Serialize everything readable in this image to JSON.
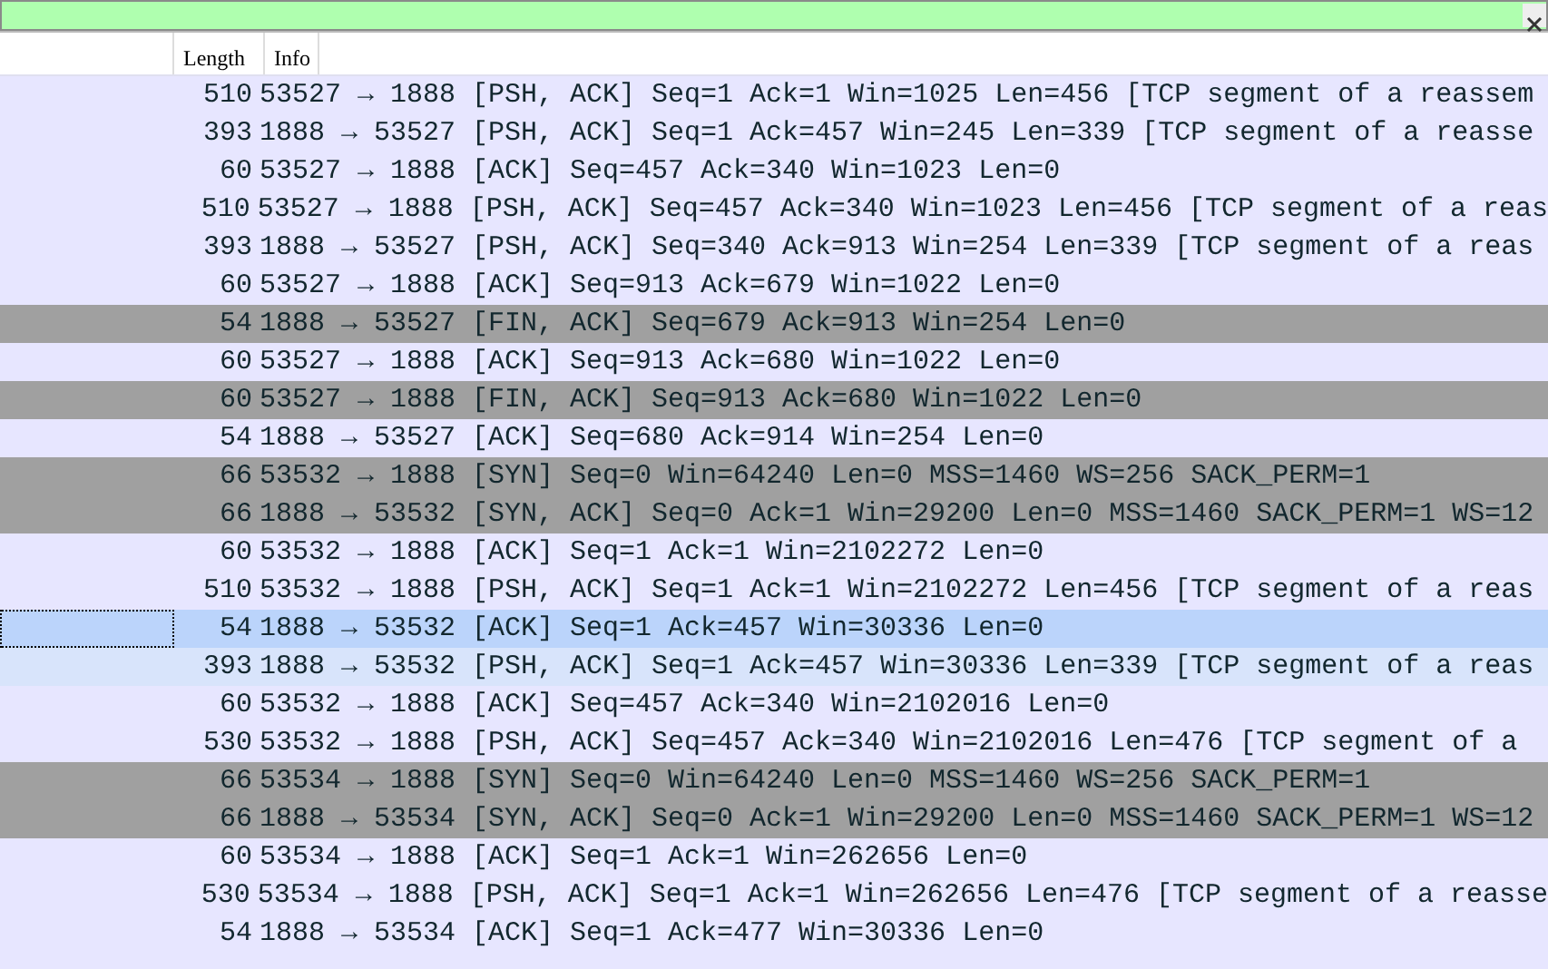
{
  "filter_bar": {
    "valid": true
  },
  "columns": [
    {
      "label": "Length"
    },
    {
      "label": "Info"
    }
  ],
  "rows": [
    {
      "length": "510",
      "info": "53527 → 1888 [PSH, ACK] Seq=1 Ack=1 Win=1025 Len=456 [TCP segment of a reassem",
      "color": "#e7e6ff",
      "selected": false
    },
    {
      "length": "393",
      "info": "1888 → 53527 [PSH, ACK] Seq=1 Ack=457 Win=245 Len=339 [TCP segment of a reasse",
      "color": "#e7e6ff",
      "selected": false
    },
    {
      "length": "60",
      "info": "53527 → 1888 [ACK] Seq=457 Ack=340 Win=1023 Len=0",
      "color": "#e7e6ff",
      "selected": false
    },
    {
      "length": "510",
      "info": "53527 → 1888 [PSH, ACK] Seq=457 Ack=340 Win=1023 Len=456 [TCP segment of a reas",
      "color": "#e7e6ff",
      "selected": false
    },
    {
      "length": "393",
      "info": "1888 → 53527 [PSH, ACK] Seq=340 Ack=913 Win=254 Len=339 [TCP segment of a reas",
      "color": "#e7e6ff",
      "selected": false
    },
    {
      "length": "60",
      "info": "53527 → 1888 [ACK] Seq=913 Ack=679 Win=1022 Len=0",
      "color": "#e7e6ff",
      "selected": false
    },
    {
      "length": "54",
      "info": "1888 → 53527 [FIN, ACK] Seq=679 Ack=913 Win=254 Len=0",
      "color": "#a0a0a0",
      "selected": false
    },
    {
      "length": "60",
      "info": "53527 → 1888 [ACK] Seq=913 Ack=680 Win=1022 Len=0",
      "color": "#e7e6ff",
      "selected": false
    },
    {
      "length": "60",
      "info": "53527 → 1888 [FIN, ACK] Seq=913 Ack=680 Win=1022 Len=0",
      "color": "#a0a0a0",
      "selected": false
    },
    {
      "length": "54",
      "info": "1888 → 53527 [ACK] Seq=680 Ack=914 Win=254 Len=0",
      "color": "#e7e6ff",
      "selected": false
    },
    {
      "length": "66",
      "info": "53532 → 1888 [SYN] Seq=0 Win=64240 Len=0 MSS=1460 WS=256 SACK_PERM=1",
      "color": "#a0a0a0",
      "selected": false
    },
    {
      "length": "66",
      "info": "1888 → 53532 [SYN, ACK] Seq=0 Ack=1 Win=29200 Len=0 MSS=1460 SACK_PERM=1 WS=12",
      "color": "#a0a0a0",
      "selected": false
    },
    {
      "length": "60",
      "info": "53532 → 1888 [ACK] Seq=1 Ack=1 Win=2102272 Len=0",
      "color": "#e7e6ff",
      "selected": false
    },
    {
      "length": "510",
      "info": "53532 → 1888 [PSH, ACK] Seq=1 Ack=1 Win=2102272 Len=456 [TCP segment of a reas",
      "color": "#e7e6ff",
      "selected": false
    },
    {
      "length": "54",
      "info": "1888 → 53532 [ACK] Seq=1 Ack=457 Win=30336 Len=0",
      "color": "#bbd4fb",
      "selected": true
    },
    {
      "length": "393",
      "info": "1888 → 53532 [PSH, ACK] Seq=1 Ack=457 Win=30336 Len=339 [TCP segment of a reas",
      "color": "#d8e4fb",
      "selected": false
    },
    {
      "length": "60",
      "info": "53532 → 1888 [ACK] Seq=457 Ack=340 Win=2102016 Len=0",
      "color": "#e7e6ff",
      "selected": false
    },
    {
      "length": "530",
      "info": "53532 → 1888 [PSH, ACK] Seq=457 Ack=340 Win=2102016 Len=476 [TCP segment of a",
      "color": "#e7e6ff",
      "selected": false
    },
    {
      "length": "66",
      "info": "53534 → 1888 [SYN] Seq=0 Win=64240 Len=0 MSS=1460 WS=256 SACK_PERM=1",
      "color": "#a0a0a0",
      "selected": false
    },
    {
      "length": "66",
      "info": "1888 → 53534 [SYN, ACK] Seq=0 Ack=1 Win=29200 Len=0 MSS=1460 SACK_PERM=1 WS=12",
      "color": "#a0a0a0",
      "selected": false
    },
    {
      "length": "60",
      "info": "53534 → 1888 [ACK] Seq=1 Ack=1 Win=262656 Len=0",
      "color": "#e7e6ff",
      "selected": false
    },
    {
      "length": "530",
      "info": "53534 → 1888 [PSH, ACK] Seq=1 Ack=1 Win=262656 Len=476 [TCP segment of a reasse",
      "color": "#e7e6ff",
      "selected": false
    },
    {
      "length": "54",
      "info": "1888 → 53534 [ACK] Seq=1 Ack=477 Win=30336 Len=0",
      "color": "#e7e6ff",
      "selected": false
    }
  ]
}
